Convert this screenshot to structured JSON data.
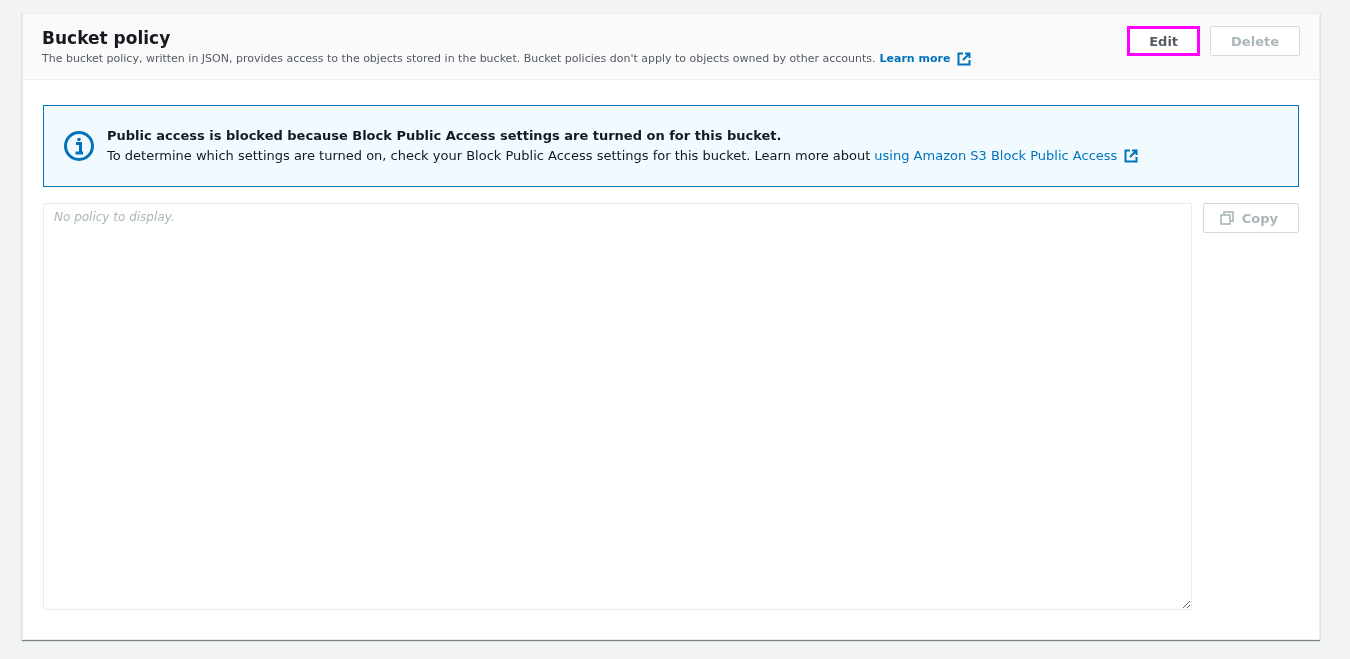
{
  "panel": {
    "title": "Bucket policy",
    "description": "The bucket policy, written in JSON, provides access to the objects stored in the bucket. Bucket policies don't apply to objects owned by other accounts.",
    "learn_more": "Learn more",
    "buttons": [
      {
        "label": "Edit",
        "disabled": false,
        "highlighted": true
      },
      {
        "label": "Delete",
        "disabled": true,
        "highlighted": false
      }
    ]
  },
  "alert": {
    "heading": "Public access is blocked because Block Public Access settings are turned on for this bucket.",
    "text": "To determine which settings are turned on, check your Block Public Access settings for this bucket. Learn more about",
    "link": "using Amazon S3 Block Public Access"
  },
  "policy": {
    "placeholder": "No policy to display.",
    "copy": {
      "label": "Copy",
      "disabled": true
    }
  }
}
